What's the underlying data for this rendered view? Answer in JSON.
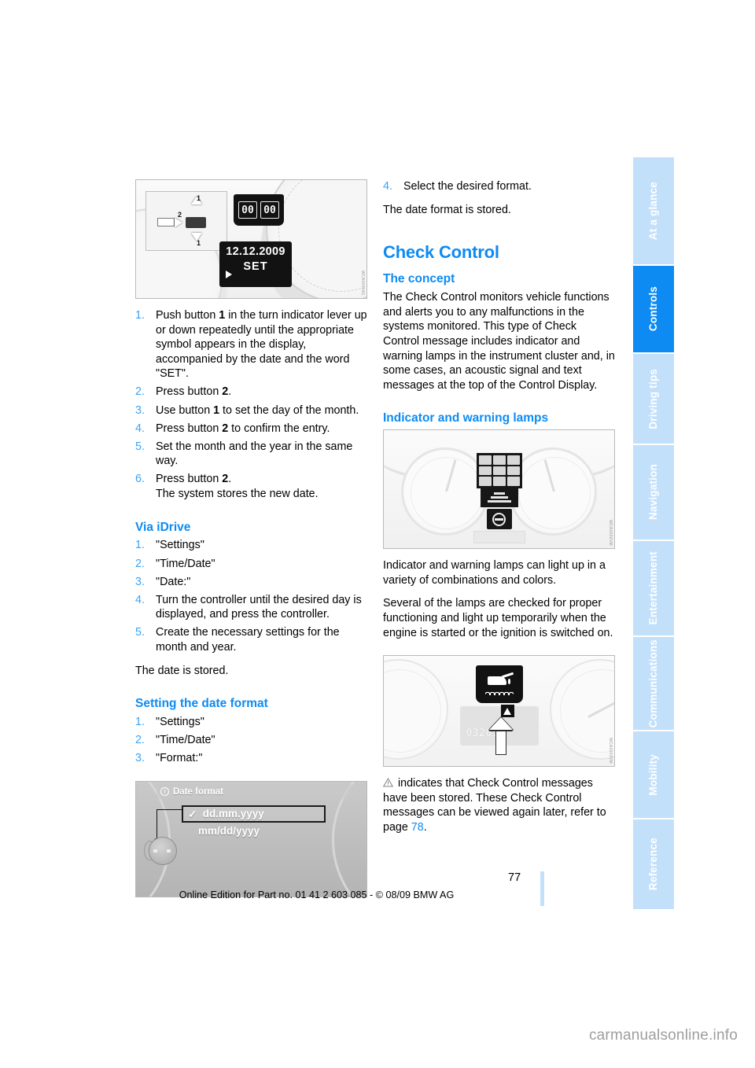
{
  "page": {
    "number": "77",
    "footer_line": "Online Edition for Part no. 01 41 2 603 085 - © 08/09 BMW AG",
    "watermark": "carmanualsonline.info",
    "accent_blue": "#0d8bf2",
    "tab_blue_inactive": "#c3e0fb"
  },
  "sidetabs": [
    {
      "label": "At a glance",
      "active": false
    },
    {
      "label": "Controls",
      "active": true
    },
    {
      "label": "Driving tips",
      "active": false
    },
    {
      "label": "Navigation",
      "active": false
    },
    {
      "label": "Entertainment",
      "active": false
    },
    {
      "label": "Communications",
      "active": false
    },
    {
      "label": "Mobility",
      "active": false
    },
    {
      "label": "Reference",
      "active": false
    }
  ],
  "left_column": {
    "figure_date_set": {
      "watermark_code": "WCA0004A1",
      "label_1": "1",
      "label_2": "2",
      "lcd_segment_left": "00",
      "lcd_segment_right": "00",
      "lcd_date": "12.12.2009",
      "lcd_set": "SET"
    },
    "steps_set_date": [
      "Push button 1 in the turn indicator lever up or down repeatedly until the appropriate symbol appears in the display, accompanied by the date and the word \"SET\".",
      "Press button 2.",
      "Use button 1 to set the day of the month.",
      "Press button 2 to confirm the entry.",
      "Set the month and the year in the same way.",
      "Press button 2. The system stores the new date."
    ],
    "via_idrive": {
      "heading": "Via iDrive",
      "steps": [
        "\"Settings\"",
        "\"Time/Date\"",
        "\"Date:\"",
        "Turn the controller until the desired day is displayed, and press the controller.",
        "Create the necessary settings for the month and year."
      ],
      "closing": "The date is stored."
    },
    "setting_date_format": {
      "heading": "Setting the date format",
      "steps": [
        "\"Settings\"",
        "\"Time/Date\"",
        "\"Format:\""
      ]
    },
    "figure_date_format": {
      "menu_title": "Date format",
      "option_selected": "dd.mm.yyyy",
      "option_other": "mm/dd/yyyy",
      "checkmark": "✓"
    }
  },
  "right_column": {
    "steps_continued": [
      "Select the desired format."
    ],
    "steps_continued_closing": "The date format is stored.",
    "check_control": {
      "heading": "Check Control",
      "concept_heading": "The concept",
      "concept_body": "The Check Control monitors vehicle functions and alerts you to any malfunctions in the systems monitored. This type of Check Control message includes indicator and warning lamps in the instrument cluster and, in some cases, an acoustic signal and text messages at the top of the Control Display."
    },
    "indicator_lamps": {
      "heading": "Indicator and warning lamps",
      "figure_cluster_watermark": "WCA0002VM",
      "body_1": "Indicator and warning lamps can light up in a variety of combinations and colors.",
      "body_2": "Several of the lamps are checked for proper functioning and light up temporarily when the engine is started or the ignition is switched on.",
      "figure_oil_watermark": "WCA0003VM",
      "figure_oil_odometer": "032050",
      "stored_messages_text_before": " indicates that Check Control messages have been stored. These Check Control messages can be viewed again later, refer to page ",
      "stored_messages_page": "78",
      "stored_messages_text_after": "."
    }
  }
}
